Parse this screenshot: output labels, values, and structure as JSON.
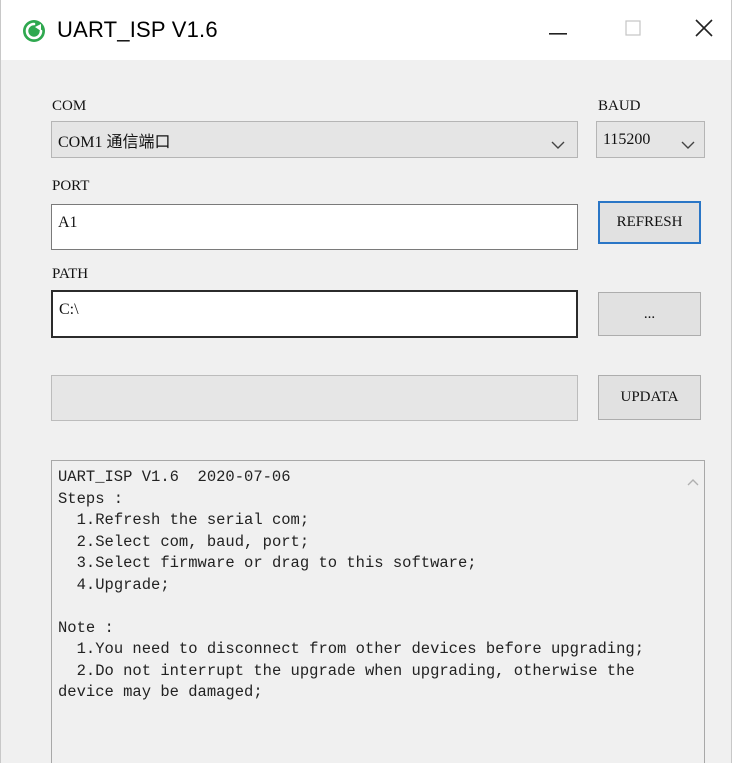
{
  "window": {
    "title": "UART_ISP V1.6",
    "icon": "green-refresh-icon",
    "accent_color": "#2a76c6",
    "background": "#f0f0f0"
  },
  "com": {
    "label": "COM",
    "selected": "COM1 通信端口"
  },
  "baud": {
    "label": "BAUD",
    "selected": "115200"
  },
  "port": {
    "label": "PORT",
    "value": "A1"
  },
  "refresh_button": {
    "label": "REFRESH"
  },
  "path": {
    "label": "PATH",
    "value": "C:\\"
  },
  "browse_button": {
    "label": "..."
  },
  "progress": {
    "value_percent": 0
  },
  "update_button": {
    "label": "UPDATA"
  },
  "log": {
    "lines": [
      "UART_ISP V1.6  2020-07-06",
      "Steps :",
      "  1.Refresh the serial com;",
      "  2.Select com, baud, port;",
      "  3.Select firmware or drag to this software;",
      "  4.Upgrade;",
      "",
      "Note :",
      "  1.You need to disconnect from other devices before upgrading;",
      "  2.Do not interrupt the upgrade when upgrading, otherwise the device may be damaged;"
    ]
  }
}
